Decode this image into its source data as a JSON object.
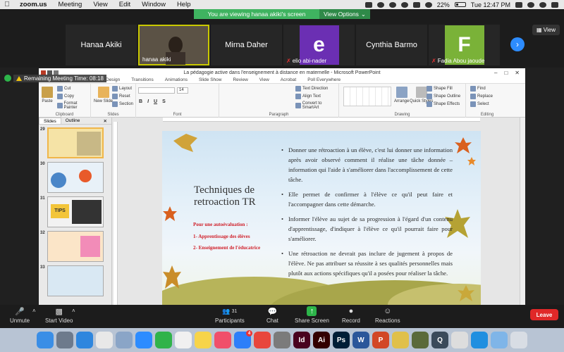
{
  "menubar": {
    "app": "zoom.us",
    "items": [
      "Meeting",
      "View",
      "Edit",
      "Window",
      "Help"
    ],
    "battery": "22%",
    "clock": "Tue 12:47 PM"
  },
  "banner": {
    "text": "You are viewing hanaa akiki's screen",
    "view_options": "View Options"
  },
  "view_label": "View",
  "participants": [
    {
      "name": "Hanaa Akiki",
      "type": "name"
    },
    {
      "name": "hanaa akiki",
      "type": "video"
    },
    {
      "name": "Mirna Daher",
      "type": "name"
    },
    {
      "name": "elio abi-nader",
      "type": "avatar",
      "letter": "e",
      "color": "#6b2fb3"
    },
    {
      "name": "Cynthia Barmo",
      "type": "name"
    },
    {
      "name": "Fadia Abou jaoude",
      "type": "avatar",
      "letter": "F",
      "color": "#7ab238"
    }
  ],
  "timer": "Remaining Meeting Time: 08:18",
  "ppt": {
    "title": "La pédagogie active  dans l'enseignement à distance  en maternelle  -  Microsoft PowerPoint",
    "tabs": [
      "Design",
      "Transitions",
      "Animations",
      "Slide Show",
      "Review",
      "View",
      "Acrobat",
      "Poll Everywhere"
    ],
    "ribbon": {
      "paste": "Paste",
      "cut": "Cut",
      "copy": "Copy",
      "format_painter": "Format Painter",
      "clipboard": "Clipboard",
      "new_slide": "New Slide",
      "layout": "Layout",
      "reset": "Reset",
      "section": "Section",
      "slides": "Slides",
      "font_size": "14",
      "font": "Font",
      "paragraph": "Paragraph",
      "text_direction": "Text Direction",
      "align_text": "Align Text",
      "convert_smartart": "Convert to SmartArt",
      "arrange": "Arrange",
      "quick_styles": "Quick Styles",
      "shape_fill": "Shape Fill",
      "shape_outline": "Shape Outline",
      "shape_effects": "Shape Effects",
      "drawing": "Drawing",
      "find": "Find",
      "replace": "Replace",
      "select": "Select",
      "editing": "Editing"
    },
    "panel_tabs": [
      "Slides",
      "Outline"
    ],
    "thumbs": [
      "29",
      "30",
      "31",
      "32",
      "33"
    ],
    "thumb_tips": "TIPS",
    "slide": {
      "title": "Techniques de retroaction TR",
      "sub1": "Pour une autoévaluation :",
      "sub2": "1- Apprentissage  des élèves",
      "sub3": "2-  Enseignement  de l'éducatrice",
      "bullets": [
        "Donner une rétroaction à un élève, c'est lui donner une information après avoir observé comment il réalise une tâche donnée – information qui l'aide à s'améliorer dans l'accomplissement de cette tâche.",
        " Elle permet de confirmer à l'élève ce qu'il peut faire et l'accompagner dans cette démarche.",
        "Informer l'élève au sujet de sa progression à l'égard d'un contenu d'apprentissage, d'indiquer à l'élève ce qu'il pourrait faire pour s'améliorer.",
        "Une rétroaction ne devrait pas inclure de jugement à propos de l'élève. Ne pas attribuer sa réussite à ses qualités personnelles mais plutôt aux actions spécifiques qu'il a posées pour réaliser la tâche."
      ]
    }
  },
  "controls": {
    "unmute": "Unmute",
    "start_video": "Start Video",
    "participants": "Participants",
    "participants_count": "31",
    "chat": "Chat",
    "share_screen": "Share Screen",
    "record": "Record",
    "reactions": "Reactions",
    "leave": "Leave"
  },
  "dock": [
    {
      "name": "finder",
      "color": "#3a8ee6",
      "label": ""
    },
    {
      "name": "launchpad",
      "color": "#6d7a8c",
      "label": ""
    },
    {
      "name": "safari",
      "color": "#2e86de",
      "label": ""
    },
    {
      "name": "chrome",
      "color": "#e8e8e8",
      "label": ""
    },
    {
      "name": "preview",
      "color": "#8aa5c7",
      "label": ""
    },
    {
      "name": "zoom",
      "color": "#2d8cff",
      "label": ""
    },
    {
      "name": "facetime",
      "color": "#30b34a",
      "label": ""
    },
    {
      "name": "photos",
      "color": "#f0f0f0",
      "label": ""
    },
    {
      "name": "notes",
      "color": "#f7d44a",
      "label": ""
    },
    {
      "name": "music",
      "color": "#f04f6a",
      "label": ""
    },
    {
      "name": "app-store",
      "color": "#2d7ff9",
      "label": "",
      "badge": "4"
    },
    {
      "name": "anydesk",
      "color": "#e8463c",
      "label": ""
    },
    {
      "name": "system-preferences",
      "color": "#7b7b7b",
      "label": ""
    },
    {
      "name": "indesign",
      "color": "#49021f",
      "label": "Id"
    },
    {
      "name": "illustrator",
      "color": "#330000",
      "label": "Ai"
    },
    {
      "name": "photoshop",
      "color": "#001e36",
      "label": "Ps"
    },
    {
      "name": "word",
      "color": "#2b579a",
      "label": "W"
    },
    {
      "name": "powerpoint",
      "color": "#d24726",
      "label": "P"
    },
    {
      "name": "sketchbook",
      "color": "#e0c04a",
      "label": ""
    },
    {
      "name": "game",
      "color": "#5a6a3a",
      "label": ""
    },
    {
      "name": "quicktime",
      "color": "#3a4a5a",
      "label": "Q"
    },
    {
      "name": "grapher",
      "color": "#dddddd",
      "label": ""
    },
    {
      "name": "accessibility",
      "color": "#1f8fe0",
      "label": ""
    },
    {
      "name": "downloads-folder",
      "color": "#7fb5e8",
      "label": ""
    },
    {
      "name": "trash",
      "color": "#d8dde4",
      "label": ""
    }
  ]
}
